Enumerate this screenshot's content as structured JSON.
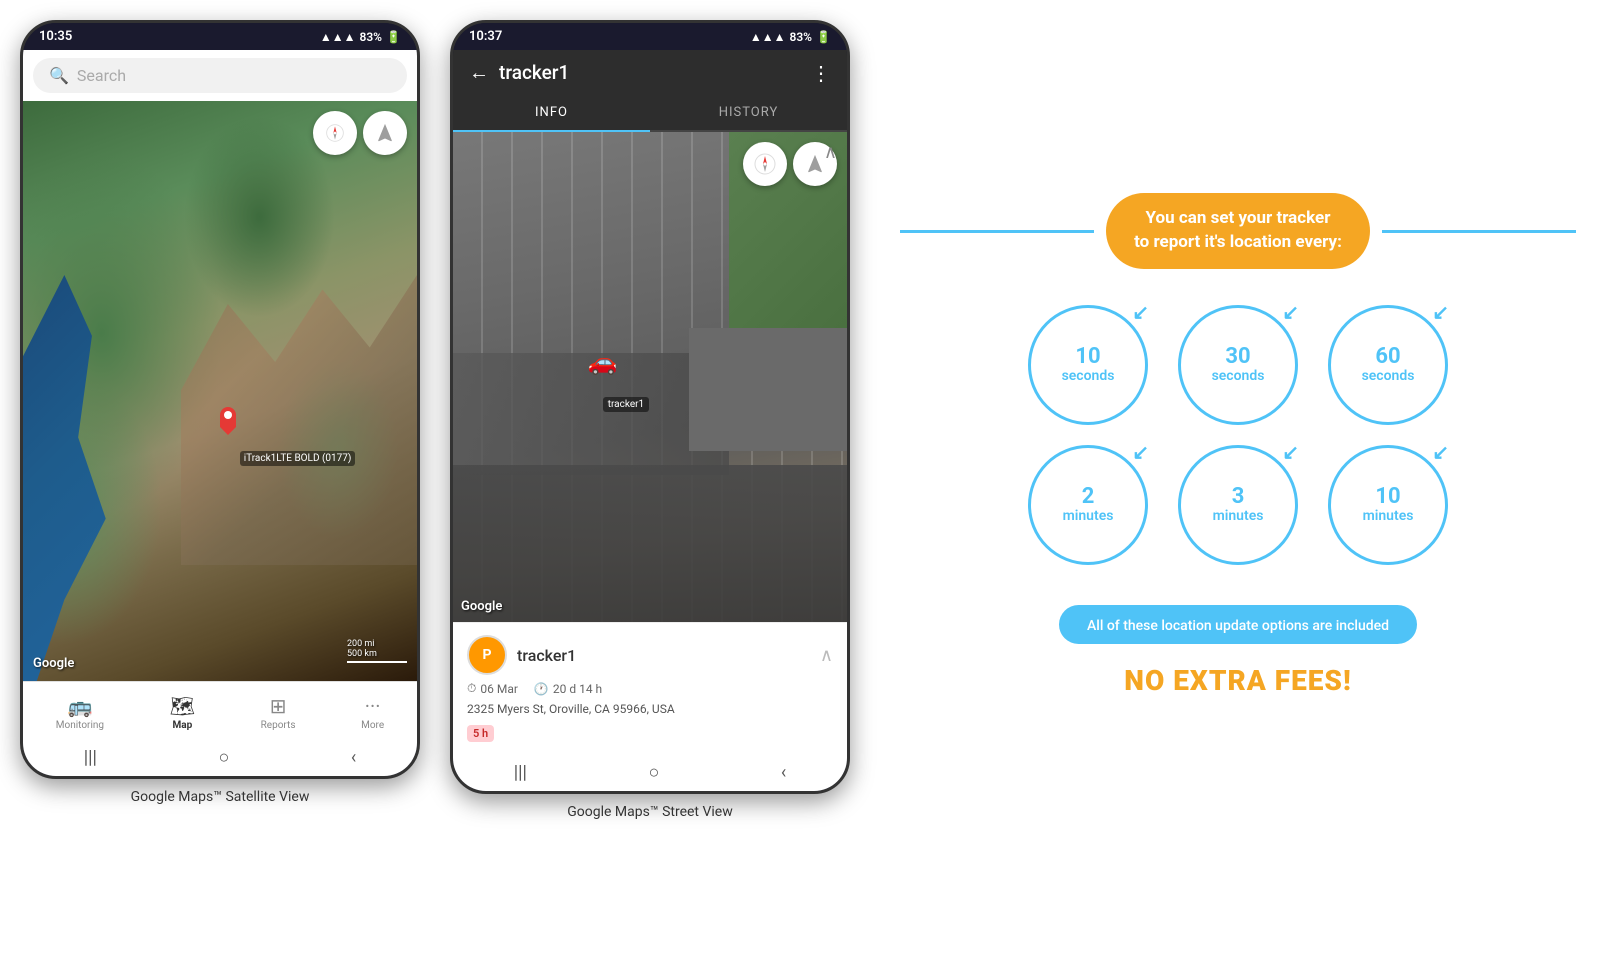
{
  "phone1": {
    "status_bar": {
      "time": "10:35",
      "signal": "▲▲▲",
      "battery": "83%"
    },
    "search": {
      "placeholder": "Search"
    },
    "map_type": "Satellite",
    "tracker_label": "iTrack1LTE BOLD (0177)",
    "google_logo": "Google",
    "scale_200mi": "200 mi",
    "scale_500km": "500 km",
    "nav": {
      "items": [
        {
          "label": "Monitoring",
          "icon": "bus"
        },
        {
          "label": "Map",
          "icon": "map",
          "active": true
        },
        {
          "label": "Reports",
          "icon": "table"
        },
        {
          "label": "More",
          "icon": "dots"
        }
      ]
    },
    "caption": "Google Maps™ Satellite View"
  },
  "phone2": {
    "status_bar": {
      "time": "10:37",
      "signal": "▲▲▲",
      "battery": "83%"
    },
    "header": {
      "title": "tracker1",
      "back": "←",
      "more": "⋮"
    },
    "tabs": [
      {
        "label": "INFO",
        "active": true
      },
      {
        "label": "HISTORY",
        "active": false
      }
    ],
    "map_type": "Street View",
    "tracker_label": "tracker1",
    "google_logo": "Google",
    "info_panel": {
      "tracker_name": "tracker1",
      "avatar_letter": "P",
      "date": "06 Mar",
      "duration": "20 d 14 h",
      "address": "2325 Myers St, Oroville, CA 95966, USA",
      "badge": "5 h"
    },
    "caption": "Google Maps™ Street View"
  },
  "promo": {
    "title": "You can set your tracker\nto report it's location every:",
    "intervals": [
      {
        "number": "10",
        "unit": "seconds"
      },
      {
        "number": "30",
        "unit": "seconds"
      },
      {
        "number": "60",
        "unit": "seconds"
      },
      {
        "number": "2",
        "unit": "minutes"
      },
      {
        "number": "3",
        "unit": "minutes"
      },
      {
        "number": "10",
        "unit": "minutes"
      }
    ],
    "banner_text": "All of these location update options are included",
    "no_extra_fees": "NO EXTRA FEES!"
  }
}
